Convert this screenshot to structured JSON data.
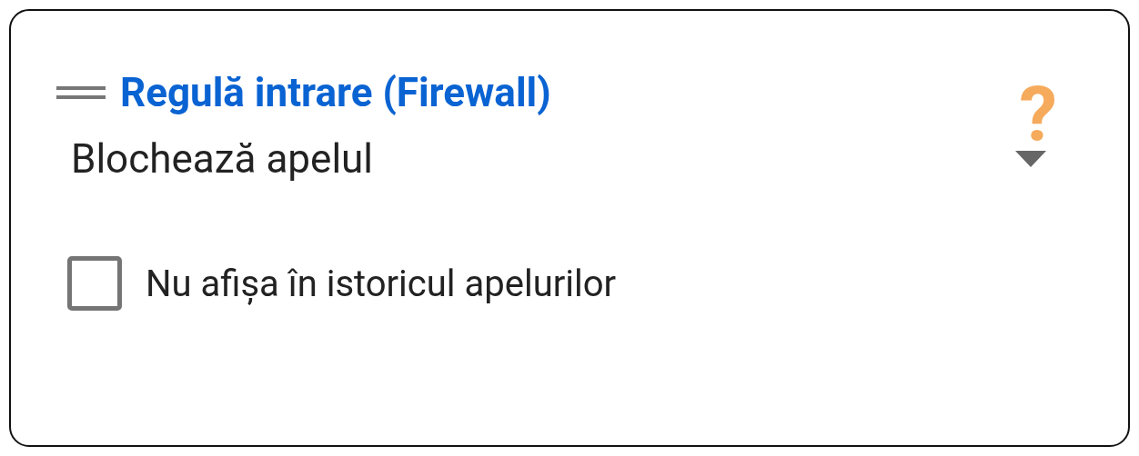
{
  "card": {
    "title": "Regulă intrare (Firewall)",
    "help": "?"
  },
  "dropdown": {
    "value": "Blochează apelul"
  },
  "checkbox": {
    "label": "Nu afișa în istoricul apelurilor",
    "checked": false
  }
}
